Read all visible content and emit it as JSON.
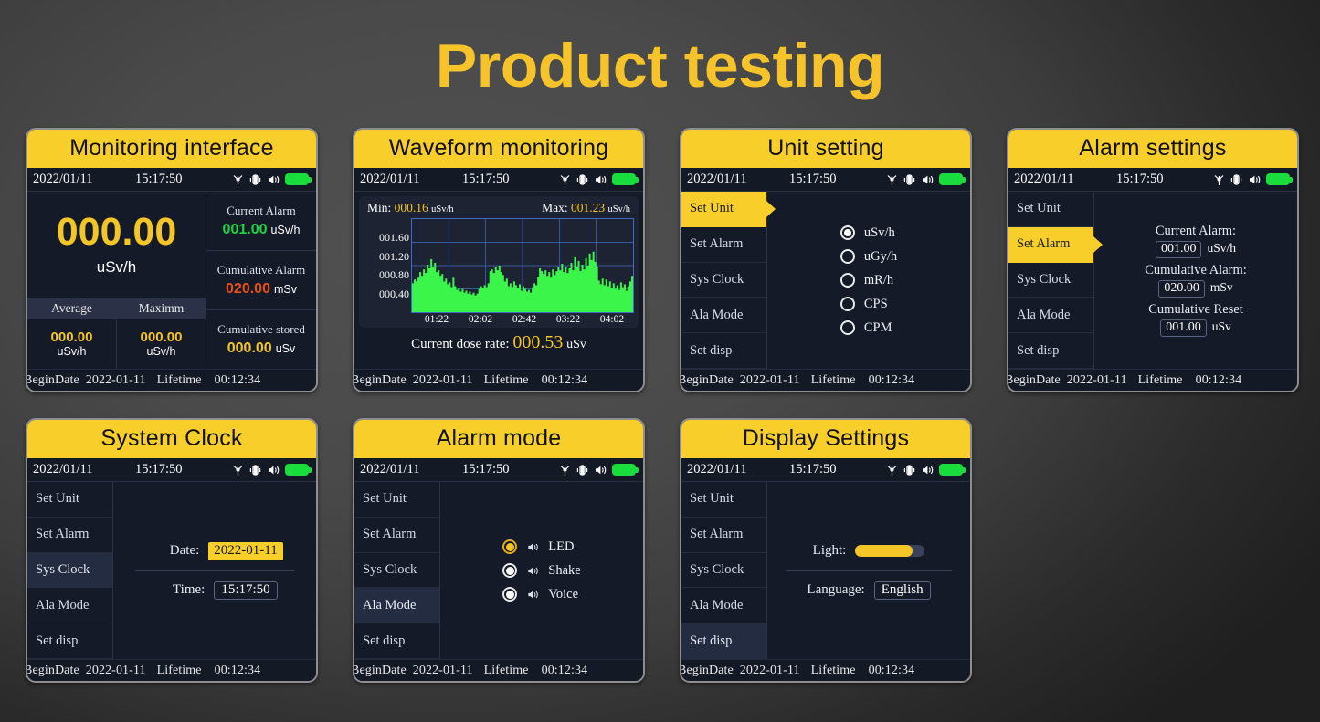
{
  "page": {
    "title": "Product testing",
    "accent": "#F6C42A",
    "background": "#4a4a4a"
  },
  "common": {
    "status": {
      "date": "2022/01/11",
      "time": "15:17:50",
      "icons": [
        "radiation-icon",
        "vibrate-icon",
        "sound-icon",
        "battery-icon"
      ],
      "battery_color": "#19DD3C"
    },
    "footer": {
      "begin_label": "BeginDate",
      "begin_date": "2022-01-11",
      "lifetime_label": "Lifetime",
      "lifetime_value": "00:12:34"
    },
    "menu": [
      "Set Unit",
      "Set Alarm",
      "Sys Clock",
      "Ala Mode",
      "Set disp"
    ]
  },
  "panels": {
    "monitoring": {
      "title": "Monitoring interface",
      "reading": {
        "value": "000.00",
        "unit": "uSv/h",
        "color": "#F4C526"
      },
      "average": {
        "header": "Average",
        "value": "000.00",
        "unit": "uSv/h"
      },
      "maximum": {
        "header": "Maximm",
        "value": "000.00",
        "unit": "uSv/h"
      },
      "current_alarm": {
        "label": "Current Alarm",
        "value": "001.00",
        "unit": "uSv/h",
        "color": "#17D63F"
      },
      "cumulative_alarm": {
        "label": "Cumulative Alarm",
        "value": "020.00",
        "unit": "mSv",
        "color": "#E8501B"
      },
      "cumulative_stored": {
        "label": "Cumulative stored",
        "value": "000.00",
        "unit": "uSv",
        "color": "#F4C526"
      }
    },
    "waveform": {
      "title": "Waveform monitoring",
      "min_label": "Min:",
      "min_value": "000.16",
      "min_unit": "uSv/h",
      "max_label": "Max:",
      "max_value": "001.23",
      "max_unit": "uSv/h",
      "current_label": "Current dose rate:",
      "current_value": "000.53",
      "current_unit": "uSv"
    },
    "unit_setting": {
      "title": "Unit setting",
      "selected_menu": "Set Unit",
      "options": [
        "uSv/h",
        "uGy/h",
        "mR/h",
        "CPS",
        "CPM"
      ],
      "selected_option": "uSv/h"
    },
    "alarm_settings": {
      "title": "Alarm settings",
      "selected_menu": "Set Alarm",
      "current_alarm": {
        "label": "Current Alarm:",
        "value": "001.00",
        "unit": "uSv/h"
      },
      "cumulative_alarm": {
        "label": "Cumulative Alarm:",
        "value": "020.00",
        "unit": "mSv"
      },
      "cumulative_reset": {
        "label": "Cumulative Reset",
        "value": "001.00",
        "unit": "uSv"
      }
    },
    "system_clock": {
      "title": "System Clock",
      "selected_menu": "Sys Clock",
      "date_label": "Date:",
      "date_value": "2022-01-11",
      "time_label": "Time:",
      "time_value": "15:17:50"
    },
    "alarm_mode": {
      "title": "Alarm mode",
      "selected_menu": "Ala Mode",
      "options": [
        "LED",
        "Shake",
        "Voice"
      ],
      "selected_option": "LED"
    },
    "display_settings": {
      "title": "Display Settings",
      "selected_menu": "Set disp",
      "light_label": "Light:",
      "light_percent": 82,
      "language_label": "Language:",
      "language_value": "English"
    }
  },
  "chart_data": {
    "type": "area",
    "title": "Waveform monitoring",
    "xlabel": "",
    "ylabel": "uSv/h",
    "ytick_labels": [
      "001.60",
      "001.20",
      "000.80",
      "000.40"
    ],
    "ytick_values": [
      1.6,
      1.2,
      0.8,
      0.4
    ],
    "xtick_labels": [
      "01:22",
      "02:02",
      "02:42",
      "03:22",
      "04:02"
    ],
    "ylim": [
      0,
      2.0
    ],
    "grid": true,
    "series_color": "#3BF54A",
    "grid_color": "#3f6cc4",
    "min": 0.16,
    "max": 1.23,
    "current": 0.53,
    "values": [
      0.62,
      0.7,
      0.66,
      0.74,
      0.86,
      0.78,
      0.92,
      0.84,
      1.02,
      0.94,
      1.14,
      0.98,
      1.06,
      0.86,
      0.9,
      0.78,
      0.82,
      0.66,
      0.72,
      0.6,
      0.64,
      0.54,
      0.74,
      0.56,
      0.48,
      0.52,
      0.44,
      0.5,
      0.42,
      0.46,
      0.4,
      0.44,
      0.38,
      0.42,
      0.36,
      0.4,
      0.5,
      0.56,
      0.52,
      0.58,
      0.54,
      0.62,
      0.88,
      0.92,
      0.84,
      0.96,
      0.9,
      1.0,
      0.86,
      0.8,
      0.66,
      0.72,
      0.56,
      0.62,
      0.54,
      0.66,
      0.58,
      0.52,
      0.6,
      0.46,
      0.56,
      0.5,
      0.44,
      0.48,
      0.42,
      0.54,
      0.62,
      0.58,
      0.76,
      0.94,
      0.88,
      0.82,
      0.9,
      0.78,
      0.86,
      0.74,
      0.92,
      0.8,
      0.88,
      0.96,
      0.9,
      1.04,
      0.86,
      0.98,
      0.84,
      0.94,
      1.06,
      0.9,
      1.18,
      0.96,
      1.1,
      0.88,
      1.02,
      0.92,
      1.16,
      1.0,
      1.26,
      1.12,
      1.3,
      1.08,
      0.96,
      0.68,
      0.6,
      0.72,
      0.58,
      0.7,
      0.56,
      0.66,
      0.52,
      0.62,
      0.5,
      0.58,
      0.48,
      0.64,
      0.54,
      0.6,
      0.46,
      0.56,
      0.66,
      0.78
    ]
  }
}
